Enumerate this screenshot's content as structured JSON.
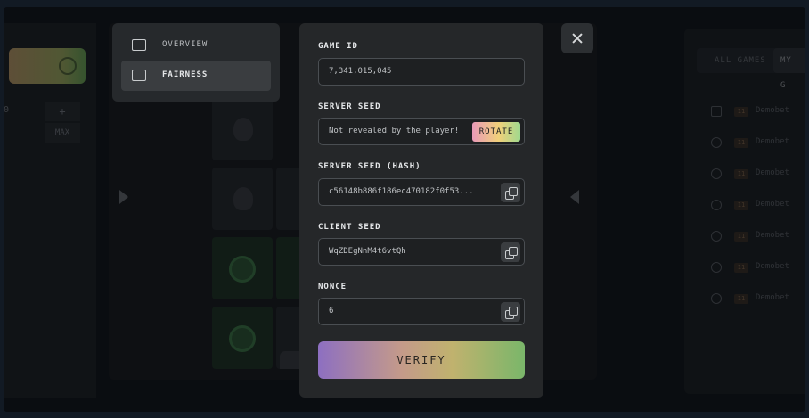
{
  "menu": {
    "items": [
      {
        "label": "OVERVIEW",
        "icon": "user-card-icon",
        "active": false
      },
      {
        "label": "FAIRNESS",
        "icon": "checkbox-icon",
        "active": true
      }
    ]
  },
  "modal": {
    "game_id": {
      "label": "GAME ID",
      "value": "7,341,015,045"
    },
    "server_seed": {
      "label": "SERVER SEED",
      "value": "Not revealed by the player!",
      "button": "ROTATE"
    },
    "server_seed_hash": {
      "label": "SERVER SEED (HASH)",
      "value": "c56148b886f186ec470182f0f53..."
    },
    "client_seed": {
      "label": "CLIENT SEED",
      "value": "WqZDEgNnM4t6vtQh"
    },
    "nonce": {
      "label": "NONCE",
      "value": "6"
    },
    "verify_label": "VERIFY"
  },
  "side": {
    "tabs": [
      "ALL GAMES",
      "MY G"
    ],
    "rows": [
      {
        "badge": "11",
        "name": "Demobet"
      },
      {
        "badge": "11",
        "name": "Demobet"
      },
      {
        "badge": "11",
        "name": "Demobet"
      },
      {
        "badge": "11",
        "name": "Demobet"
      },
      {
        "badge": "11",
        "name": "Demobet"
      },
      {
        "badge": "11",
        "name": "Demobet"
      },
      {
        "badge": "11",
        "name": "Demobet"
      }
    ]
  },
  "controls": {
    "plus": "+",
    "max": "MAX",
    "value": "0"
  },
  "colors": {
    "accent_gradient": [
      "#8d6fc1",
      "#c0b26e",
      "#7ab66a"
    ],
    "modal_bg": "#252729"
  }
}
